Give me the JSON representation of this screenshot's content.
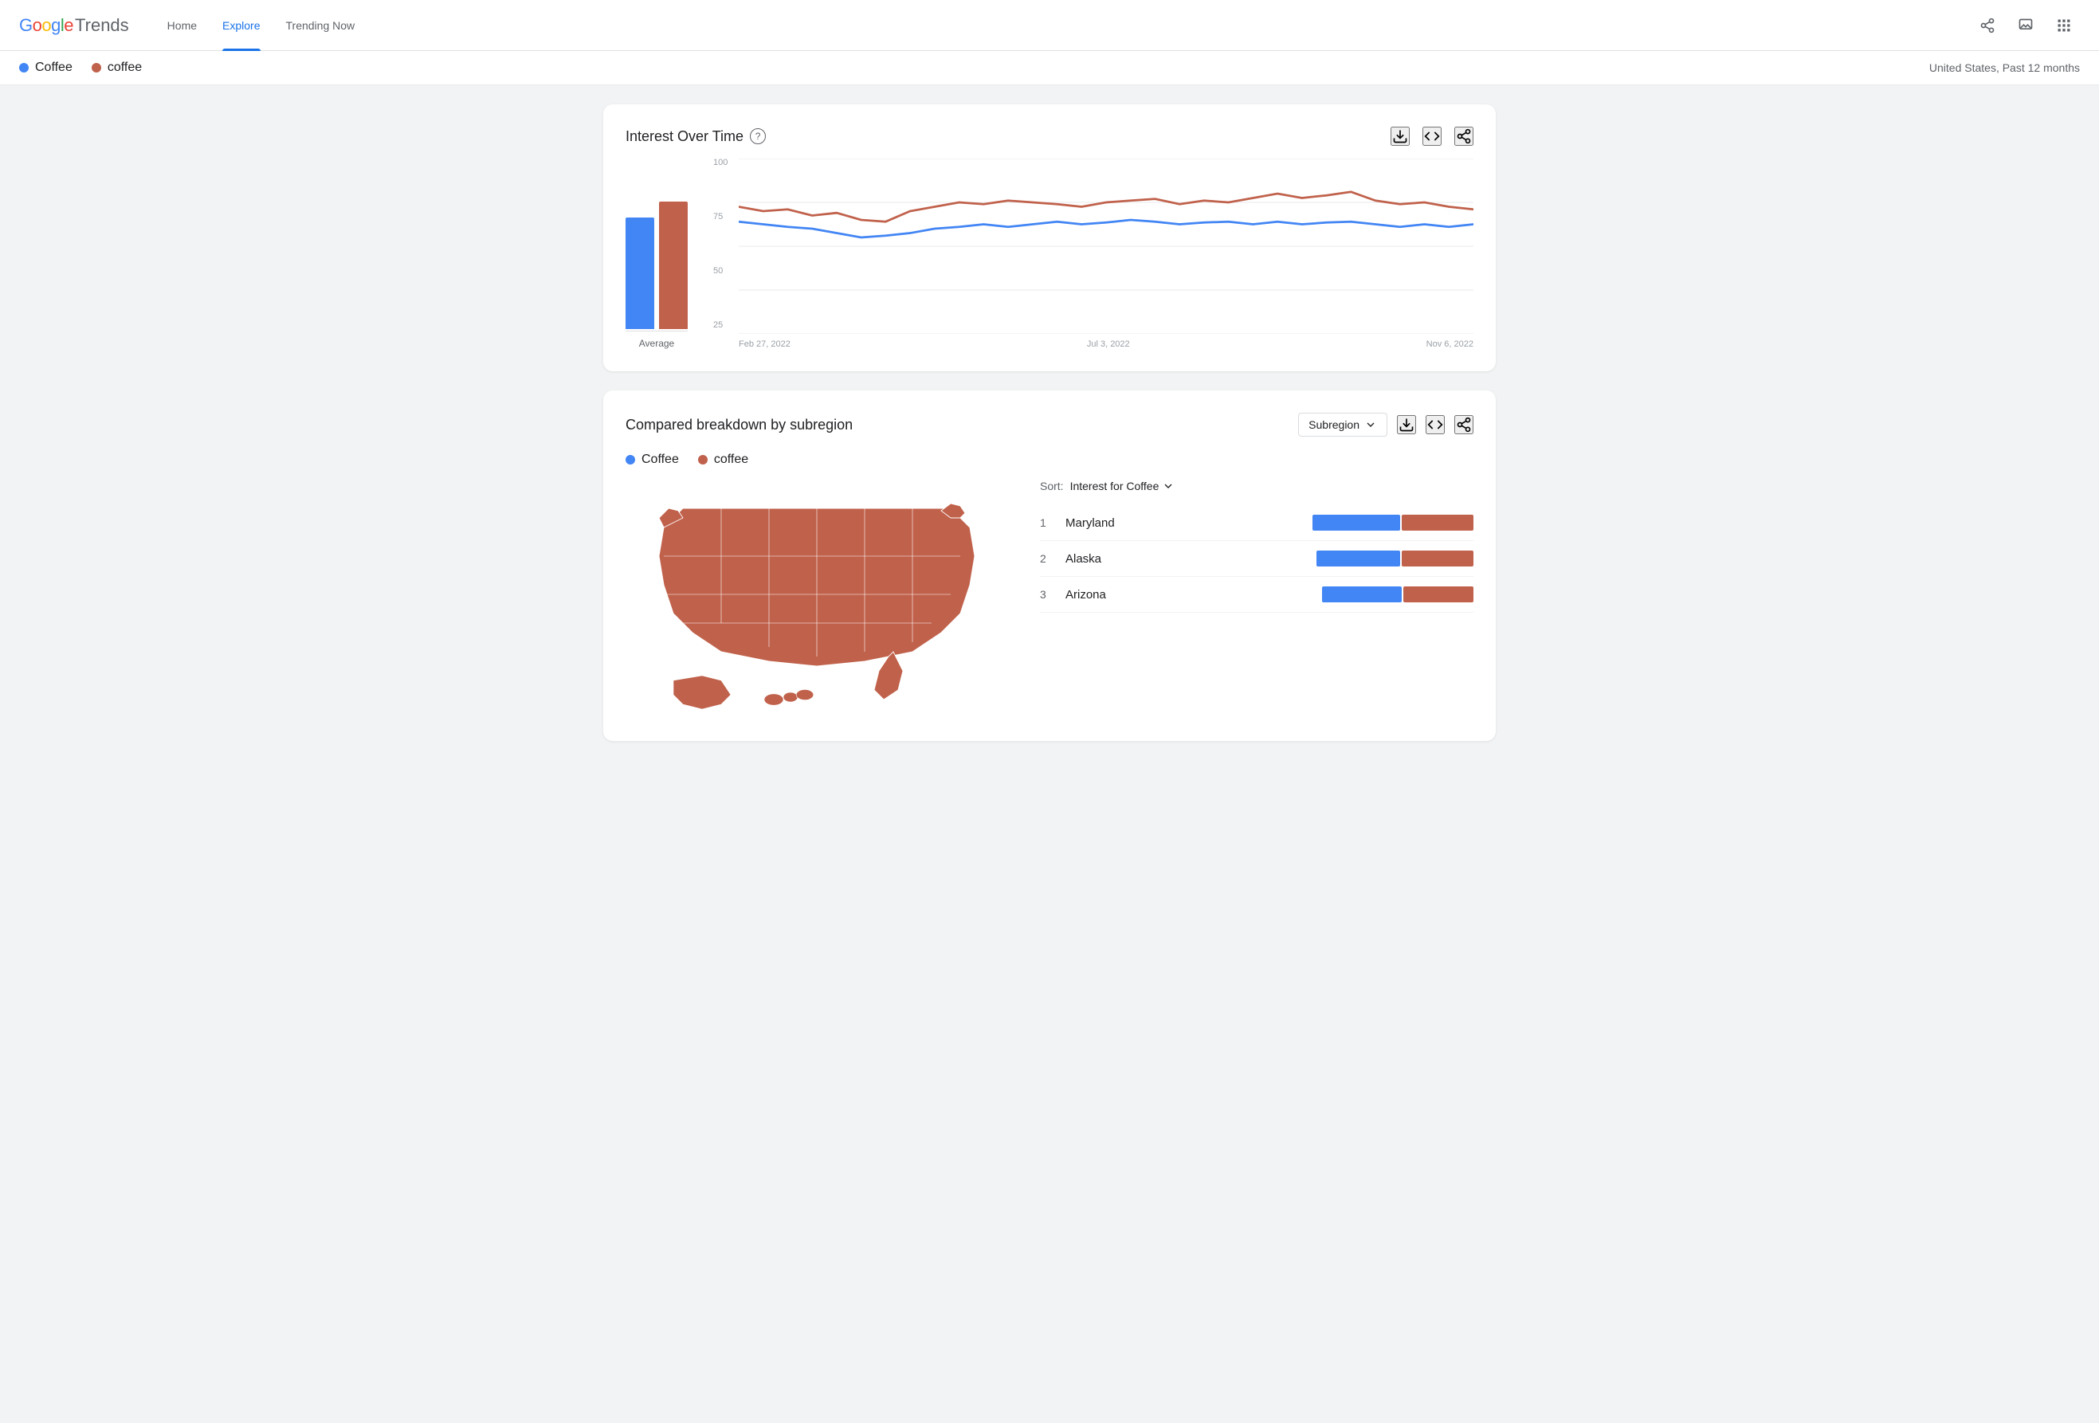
{
  "header": {
    "logo_google": "Google",
    "logo_trends": "Trends",
    "nav": [
      {
        "id": "home",
        "label": "Home",
        "active": false
      },
      {
        "id": "explore",
        "label": "Explore",
        "active": true
      },
      {
        "id": "trending",
        "label": "Trending Now",
        "active": false
      }
    ],
    "actions": {
      "share_icon": "share",
      "feedback_icon": "feedback",
      "apps_icon": "apps"
    }
  },
  "search_bar": {
    "term1_label": "Coffee",
    "term1_dot": "blue",
    "term2_label": "coffee",
    "term2_dot": "red",
    "location_time": "United States, Past 12 months"
  },
  "interest_over_time": {
    "title": "Interest Over Time",
    "help_label": "?",
    "actions": {
      "download": "↓",
      "embed": "<>",
      "share": "share"
    },
    "avg_label": "Average",
    "y_axis_labels": [
      "100",
      "75",
      "50",
      "25"
    ],
    "x_axis_labels": [
      "Feb 27, 2022",
      "Jul 3, 2022",
      "Nov 6, 2022"
    ],
    "blue_avg_height_pct": 77,
    "red_avg_height_pct": 88
  },
  "breakdown": {
    "title": "Compared breakdown by subregion",
    "dropdown_label": "Subregion",
    "legend_term1": "Coffee",
    "legend_term2": "coffee",
    "sort_label": "Sort:",
    "sort_value": "Interest for Coffee",
    "regions": [
      {
        "rank": 1,
        "name": "Maryland",
        "blue_width": 110,
        "red_width": 90
      },
      {
        "rank": 2,
        "name": "Alaska",
        "blue_width": 105,
        "red_width": 90
      },
      {
        "rank": 3,
        "name": "Arizona",
        "blue_width": 100,
        "red_width": 88
      }
    ]
  }
}
